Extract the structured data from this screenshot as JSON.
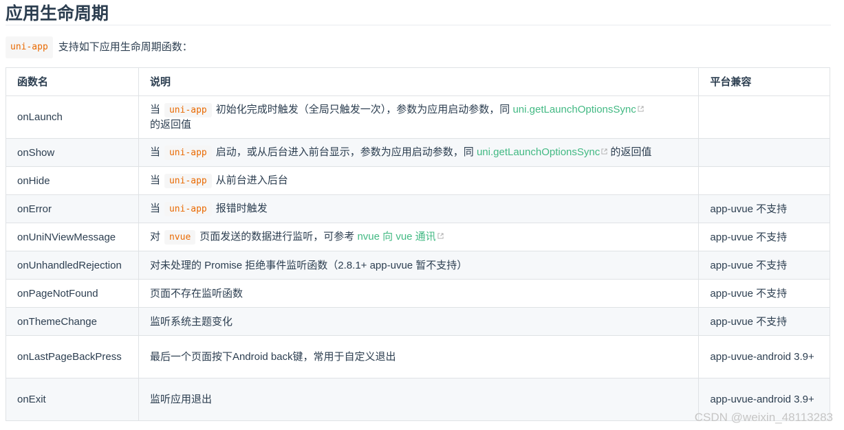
{
  "heading": "应用生命周期",
  "intro": {
    "code": "uni-app",
    "text": "支持如下应用生命周期函数："
  },
  "table": {
    "headers": [
      "函数名",
      "说明",
      "平台兼容"
    ],
    "rows": [
      {
        "name": "onLaunch",
        "desc_pre": "当",
        "code": "uni-app",
        "desc_mid": "初始化完成时触发（全局只触发一次），参数为应用启动参数，同",
        "link": "uni.getLaunchOptionsSync",
        "desc_post": "的返回值",
        "compat": ""
      },
      {
        "name": "onShow",
        "desc_pre": "当",
        "code": "uni-app",
        "desc_mid": "启动，或从后台进入前台显示，参数为应用启动参数，同",
        "link": "uni.getLaunchOptionsSync",
        "desc_post": "的返回值",
        "compat": ""
      },
      {
        "name": "onHide",
        "desc_pre": "当",
        "code": "uni-app",
        "desc_mid": "从前台进入后台",
        "compat": ""
      },
      {
        "name": "onError",
        "desc_pre": "当",
        "code": "uni-app",
        "desc_mid": "报错时触发",
        "compat": "app-uvue 不支持"
      },
      {
        "name": "onUniNViewMessage",
        "desc_pre": "对",
        "code": "nvue",
        "desc_mid": "页面发送的数据进行监听，可参考",
        "link": "nvue 向 vue 通讯",
        "compat": "app-uvue 不支持"
      },
      {
        "name": "onUnhandledRejection",
        "desc": "对未处理的 Promise 拒绝事件监听函数（2.8.1+ app-uvue 暂不支持）",
        "compat": "app-uvue 不支持"
      },
      {
        "name": "onPageNotFound",
        "desc": "页面不存在监听函数",
        "compat": "app-uvue 不支持"
      },
      {
        "name": "onThemeChange",
        "desc": "监听系统主题变化",
        "compat": "app-uvue 不支持"
      },
      {
        "name": "onLastPageBackPress",
        "desc": "最后一个页面按下Android back键，常用于自定义退出",
        "compat": "app-uvue-android 3.9+"
      },
      {
        "name": "onExit",
        "desc": "监听应用退出",
        "compat": "app-uvue-android 3.9+"
      }
    ]
  },
  "watermark": "CSDN @weixin_48113283",
  "colors": {
    "text": "#2c3e50",
    "link": "#42b983",
    "code": "#e96900",
    "code_bg": "#f6f6f6",
    "border": "#dfe2e5",
    "stripe": "#f6f8fa"
  },
  "icons": {
    "external_link": "external-link-icon"
  }
}
